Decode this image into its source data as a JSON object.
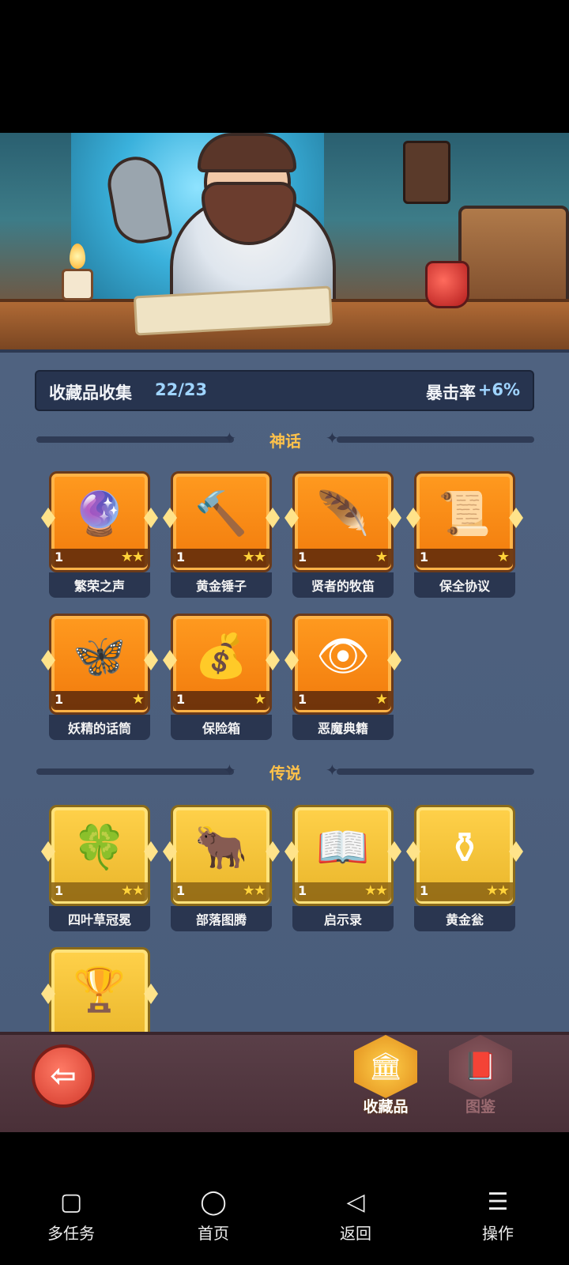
{
  "header": {
    "collection_title": "收藏品收集",
    "collection_count": "22/23",
    "stat_label": "暴击率",
    "stat_value": "+6%"
  },
  "sections": {
    "mythic": {
      "label": "神话",
      "items": [
        {
          "name": "繁荣之声",
          "level": "1",
          "stars": "★★",
          "icon": "orb-icon"
        },
        {
          "name": "黄金锤子",
          "level": "1",
          "stars": "★★",
          "icon": "hammer-icon"
        },
        {
          "name": "贤者的牧笛",
          "level": "1",
          "stars": "★",
          "icon": "flute-icon"
        },
        {
          "name": "保全协议",
          "level": "1",
          "stars": "★",
          "icon": "scroll-icon"
        },
        {
          "name": "妖精的话筒",
          "level": "1",
          "stars": "★",
          "icon": "fairy-mic-icon"
        },
        {
          "name": "保险箱",
          "level": "1",
          "stars": "★",
          "icon": "treasure-chest-icon"
        },
        {
          "name": "恶魔典籍",
          "level": "1",
          "stars": "★",
          "icon": "demon-book-icon"
        }
      ]
    },
    "legend": {
      "label": "传说",
      "items": [
        {
          "name": "四叶草冠冕",
          "level": "1",
          "stars": "★★",
          "icon": "clover-crown-icon"
        },
        {
          "name": "部落图腾",
          "level": "1",
          "stars": "★★",
          "icon": "totem-icon"
        },
        {
          "name": "启示录",
          "level": "1",
          "stars": "★★",
          "icon": "book-icon"
        },
        {
          "name": "黄金瓮",
          "level": "1",
          "stars": "★★",
          "icon": "urn-icon"
        },
        {
          "name": "",
          "level": "",
          "stars": "",
          "icon": "goblet-icon"
        }
      ]
    }
  },
  "tabs": {
    "collection": "收藏品",
    "catalog": "图鉴"
  },
  "navbar": {
    "multitask": "多任务",
    "home": "首页",
    "back": "返回",
    "actions": "操作"
  }
}
